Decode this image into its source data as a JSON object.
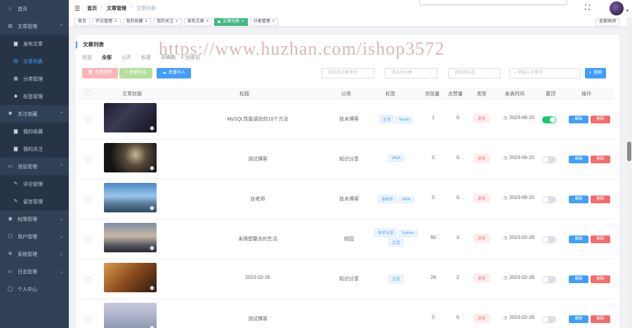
{
  "sidebar": {
    "items": [
      {
        "label": "首页",
        "icon": "home-icon",
        "glyph": "⌂",
        "sub": false,
        "chev": ""
      },
      {
        "label": "文章管理",
        "icon": "document-icon",
        "glyph": "▤",
        "sub": false,
        "chev": "⌃"
      },
      {
        "label": "发布文章",
        "icon": "edit-icon",
        "glyph": "▆",
        "sub": true,
        "active": false
      },
      {
        "label": "文章列表",
        "icon": "list-icon",
        "glyph": "▤",
        "sub": true,
        "active": true
      },
      {
        "label": "分类管理",
        "icon": "grid-icon",
        "glyph": "▦",
        "sub": true,
        "active": false
      },
      {
        "label": "标签管理",
        "icon": "tag-icon",
        "glyph": "◆",
        "sub": true,
        "active": false
      },
      {
        "label": "关注收藏",
        "icon": "star-icon",
        "glyph": "✱",
        "sub": false,
        "chev": "⌃"
      },
      {
        "label": "我的收藏",
        "icon": "collect-icon",
        "glyph": "▆",
        "sub": true,
        "active": false
      },
      {
        "label": "我的关注",
        "icon": "follow-icon",
        "glyph": "▆",
        "sub": true,
        "active": false
      },
      {
        "label": "消息管理",
        "icon": "message-icon",
        "glyph": "▭",
        "sub": false,
        "chev": "⌃"
      },
      {
        "label": "评论管理",
        "icon": "comment-icon",
        "glyph": "✎",
        "sub": true,
        "active": false
      },
      {
        "label": "留言管理",
        "icon": "note-icon",
        "glyph": "✎",
        "sub": true,
        "active": false
      },
      {
        "label": "权限管理",
        "icon": "lock-icon",
        "glyph": "◉",
        "sub": false,
        "chev": "⌄"
      },
      {
        "label": "用户管理",
        "icon": "user-icon",
        "glyph": "▢",
        "sub": false,
        "chev": "⌄"
      },
      {
        "label": "系统管理",
        "icon": "gear-icon",
        "glyph": "✲",
        "sub": false,
        "chev": "⌄"
      },
      {
        "label": "日志管理",
        "icon": "log-icon",
        "glyph": "▭",
        "sub": false,
        "chev": "⌄"
      },
      {
        "label": "个人中心",
        "icon": "person-icon",
        "glyph": "◯",
        "sub": false,
        "chev": ""
      }
    ]
  },
  "navbar": {
    "breadcrumb": [
      "首页",
      "文章管理",
      "文章列表"
    ],
    "separator": "/"
  },
  "tags": [
    {
      "label": "首页",
      "active": false,
      "closable": false
    },
    {
      "label": "评论管理",
      "active": false,
      "closable": true
    },
    {
      "label": "我的收藏",
      "active": false,
      "closable": true
    },
    {
      "label": "我的关注",
      "active": false,
      "closable": true
    },
    {
      "label": "发布文章",
      "active": false,
      "closable": true
    },
    {
      "label": "文章列表",
      "active": true,
      "closable": true
    },
    {
      "label": "分类管理",
      "active": false,
      "closable": true
    }
  ],
  "close_all_label": "全部关闭",
  "card": {
    "title": "文章列表",
    "status_label": "状态",
    "status_tabs": [
      "全部",
      "公开",
      "私密",
      "草稿箱",
      "回收站"
    ]
  },
  "toolbar": {
    "batch_delete": "批量删除",
    "batch_export": "批量导出",
    "batch_import": "批量导入",
    "type_placeholder": "请选择文章类型",
    "category_placeholder": "请选择分类",
    "tag_placeholder": "请选择标签",
    "keyword_placeholder": "请输入文章名",
    "search_label": "搜索"
  },
  "table": {
    "columns": [
      "文章封面",
      "标题",
      "分类",
      "标签",
      "浏览量",
      "点赞量",
      "类型",
      "发表时间",
      "置顶",
      "操作"
    ],
    "edit_label": "编辑",
    "delete_label": "删除",
    "rows": [
      {
        "title": "MySQL性能调优的10个方法",
        "category": "技术博客",
        "tags": [
          "生活",
          "Mysql"
        ],
        "views": "1",
        "likes": "0",
        "type": "原创",
        "date": "2023-06-20",
        "top": true,
        "thumb": "dark"
      },
      {
        "title": "测试博客",
        "category": "知识分享",
        "tags": [
          "JAVA"
        ],
        "views": "0",
        "likes": "0",
        "type": "原创",
        "date": "2023-06-22",
        "top": false,
        "thumb": "night"
      },
      {
        "title": "张老师",
        "category": "技术博客",
        "tags": [
          "张老师",
          "JAVA"
        ],
        "views": "0",
        "likes": "0",
        "type": "原创",
        "date": "2023-06-22",
        "top": false,
        "thumb": "sky"
      },
      {
        "title": "未得想要去的生活",
        "category": "校园",
        "tags": [
          "技术分享",
          "Python",
          "生活"
        ],
        "views": "60",
        "likes": "3",
        "type": "原创",
        "date": "2023-02-26",
        "top": false,
        "thumb": "dusk"
      },
      {
        "title": "2023-02-26",
        "category": "知识分享",
        "tags": [
          "生活"
        ],
        "views": "28",
        "likes": "2",
        "type": "原创",
        "date": "2023-02-26",
        "top": false,
        "thumb": "warm"
      },
      {
        "title": "测试博客",
        "category": "",
        "tags": [],
        "views": "0",
        "likes": "0",
        "type": "原创",
        "date": "2023-02-26",
        "top": false,
        "thumb": "grey"
      }
    ]
  },
  "watermark": "https://www.huzhan.com/ishop3572"
}
